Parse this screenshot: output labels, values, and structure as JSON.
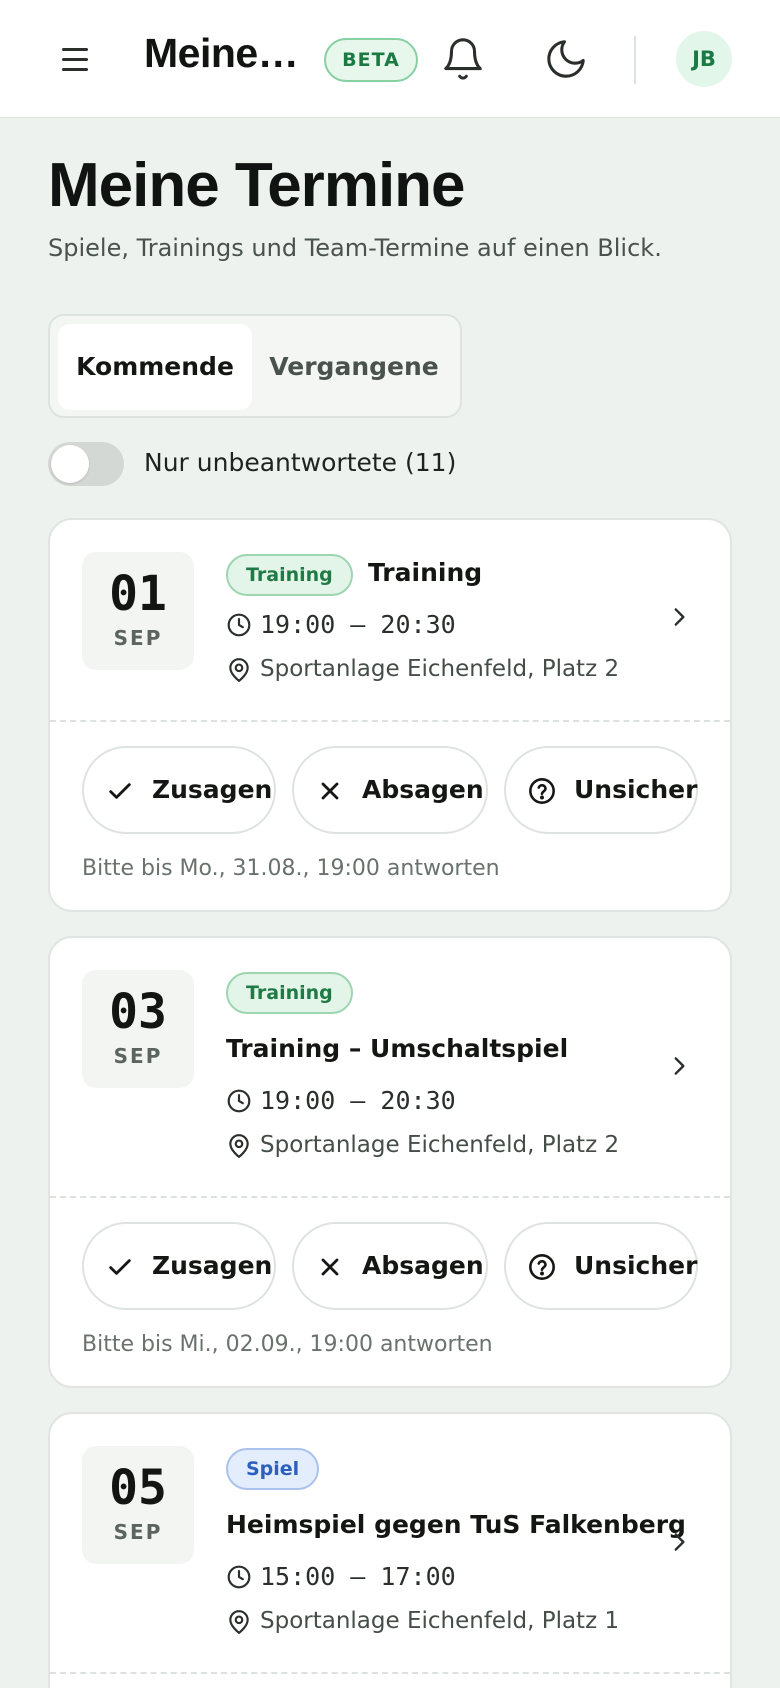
{
  "header": {
    "app_title": "Meine Termine",
    "beta": "BETA",
    "avatar_initials": "JB",
    "icons": [
      "menu-icon",
      "bell-icon",
      "moon-icon"
    ]
  },
  "page": {
    "title": "Meine Termine",
    "subtitle": "Spiele, Trainings und Team-Termine auf einen Blick."
  },
  "tabs": [
    {
      "label": "Kommende",
      "active": true
    },
    {
      "label": "Vergangene",
      "active": false
    }
  ],
  "filter": {
    "label": "Nur unbeantwortete (11)",
    "on": false
  },
  "actions": {
    "accept": "Zusagen",
    "decline": "Absagen",
    "unsure": "Unsicher"
  },
  "events": [
    {
      "day": "01",
      "month": "SEP",
      "badge": "Training",
      "badge_type": "training",
      "title": "Training",
      "time": "19:00 – 20:30",
      "location": "Sportanlage Eichenfeld, Platz 2",
      "deadline": "Bitte bis Mo., 31.08., 19:00 antworten"
    },
    {
      "day": "03",
      "month": "SEP",
      "badge": "Training",
      "badge_type": "training",
      "title": "Training – Umschaltspiel",
      "time": "19:00 – 20:30",
      "location": "Sportanlage Eichenfeld, Platz 2",
      "deadline": "Bitte bis Mi., 02.09., 19:00 antworten"
    },
    {
      "day": "05",
      "month": "SEP",
      "badge": "Spiel",
      "badge_type": "spiel",
      "title": "Heimspiel gegen TuS Falkenberg",
      "time": "15:00 – 17:00",
      "location": "Sportanlage Eichenfeld, Platz 1"
    }
  ],
  "colors": {
    "accent_green": "#1b7a43",
    "background": "#eef2ef",
    "spiel_blue": "#2c5fc0"
  }
}
